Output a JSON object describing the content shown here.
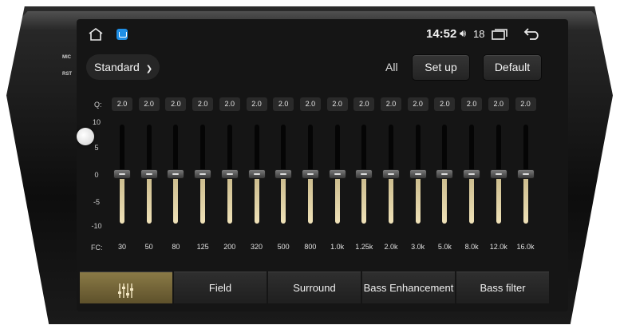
{
  "device": {
    "side_labels": {
      "mic": "MIC",
      "rst": "RST"
    }
  },
  "statusbar": {
    "time": "14:52",
    "volume_level": "18",
    "icons": [
      "home-icon",
      "app-icon",
      "volume-icon",
      "recent-apps-icon",
      "back-icon"
    ]
  },
  "header": {
    "preset_label": "Standard",
    "all_label": "All",
    "setup_label": "Set up",
    "default_label": "Default"
  },
  "eq": {
    "q_label": "Q:",
    "fc_label": "FC:",
    "scale": [
      "10",
      "5",
      "0",
      "-5",
      "-10"
    ],
    "gain_range": [
      -10,
      10
    ],
    "bands": [
      {
        "q": "2.0",
        "fc": "30",
        "gain": 0
      },
      {
        "q": "2.0",
        "fc": "50",
        "gain": 0
      },
      {
        "q": "2.0",
        "fc": "80",
        "gain": 0
      },
      {
        "q": "2.0",
        "fc": "125",
        "gain": 0
      },
      {
        "q": "2.0",
        "fc": "200",
        "gain": 0
      },
      {
        "q": "2.0",
        "fc": "320",
        "gain": 0
      },
      {
        "q": "2.0",
        "fc": "500",
        "gain": 0
      },
      {
        "q": "2.0",
        "fc": "800",
        "gain": 0
      },
      {
        "q": "2.0",
        "fc": "1.0k",
        "gain": 0
      },
      {
        "q": "2.0",
        "fc": "1.25k",
        "gain": 0
      },
      {
        "q": "2.0",
        "fc": "2.0k",
        "gain": 0
      },
      {
        "q": "2.0",
        "fc": "3.0k",
        "gain": 0
      },
      {
        "q": "2.0",
        "fc": "5.0k",
        "gain": 0
      },
      {
        "q": "2.0",
        "fc": "8.0k",
        "gain": 0
      },
      {
        "q": "2.0",
        "fc": "12.0k",
        "gain": 0
      },
      {
        "q": "2.0",
        "fc": "16.0k",
        "gain": 0
      }
    ]
  },
  "tabs": [
    {
      "label": "",
      "icon": "equalizer-icon",
      "active": true
    },
    {
      "label": "Field",
      "active": false
    },
    {
      "label": "Surround",
      "active": false
    },
    {
      "label": "Bass Enhancement",
      "active": false
    },
    {
      "label": "Bass filter",
      "active": false
    }
  ],
  "colors": {
    "accent_gold": "#8a7a46",
    "slider_fill": "#efe2b8",
    "screen_bg": "#151515"
  }
}
